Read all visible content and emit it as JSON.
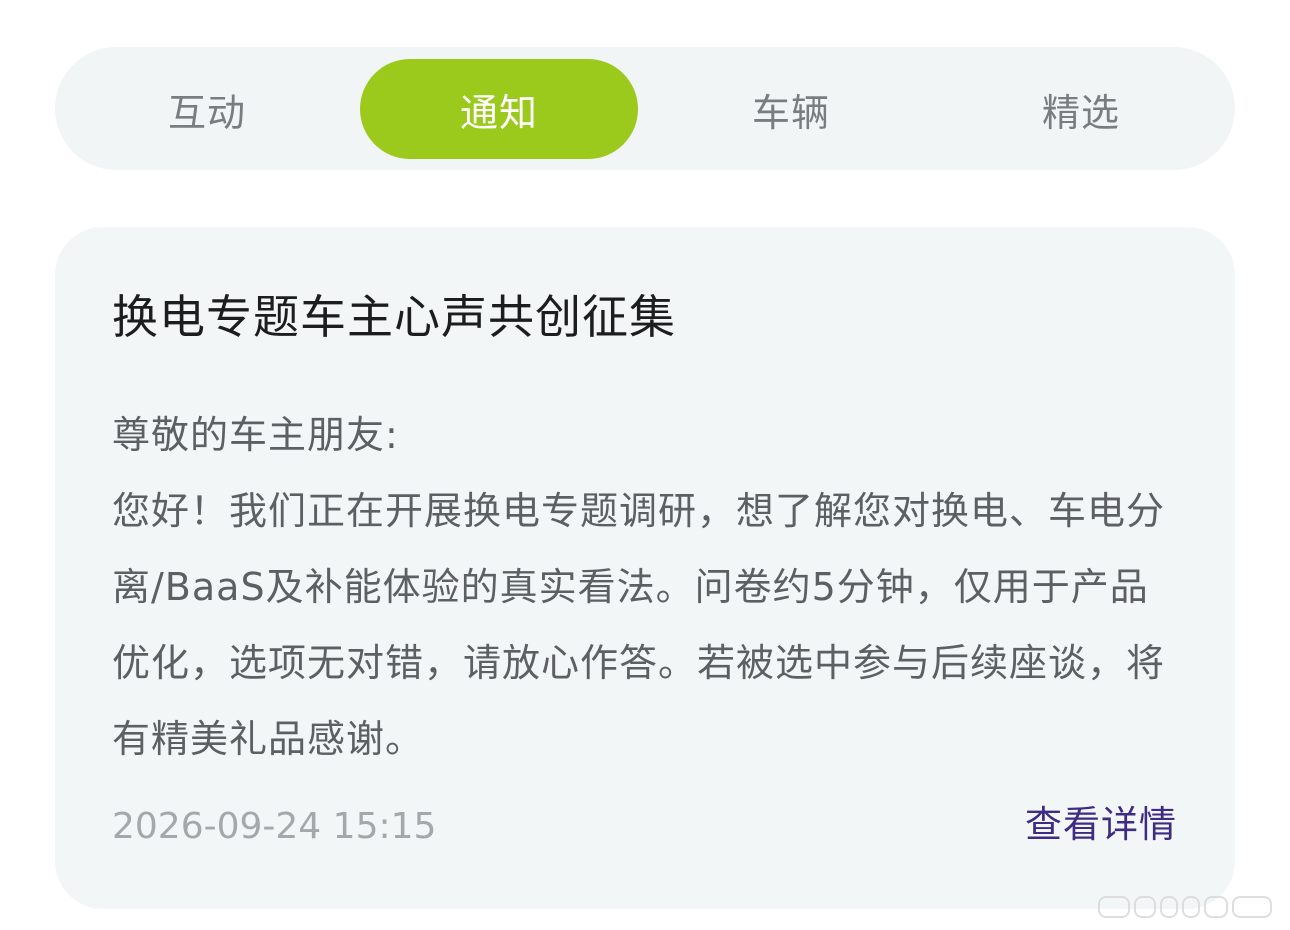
{
  "tabs": [
    {
      "label": "互动",
      "active": false
    },
    {
      "label": "通知",
      "active": true
    },
    {
      "label": "车辆",
      "active": false
    },
    {
      "label": "精选",
      "active": false
    }
  ],
  "colors": {
    "accent": "#9bc91c",
    "link": "#3f2b83"
  },
  "notification": {
    "title": "换电专题车主心声共创征集",
    "greeting": "尊敬的车主朋友:",
    "body": "您好！我们正在开展换电专题调研，想了解您对换电、车电分离/BaaS及补能体验的真实看法。问卷约5分钟，仅用于产品优化，选项无对错，请放心作答。若被选中参与后续座谈，将有精美礼品感谢。",
    "timestamp": "2026-09-24 15:15",
    "detail_label": "查看详情"
  }
}
